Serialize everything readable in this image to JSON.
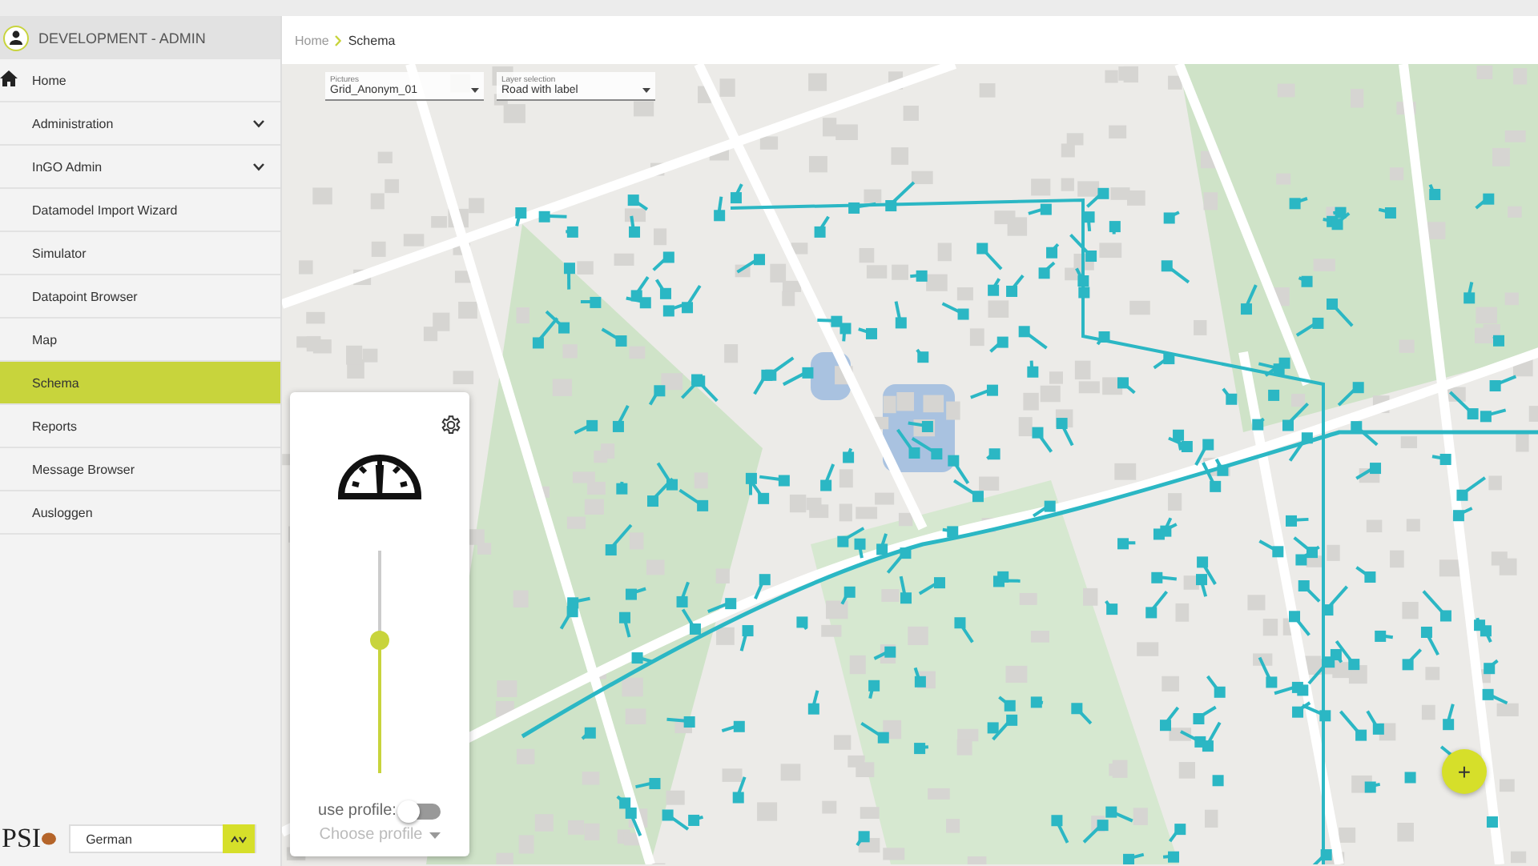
{
  "sidebar": {
    "user": "DEVELOPMENT - ADMIN",
    "items": [
      {
        "label": "Home",
        "kind": "home",
        "selected": false
      },
      {
        "label": "Administration",
        "kind": "group",
        "selected": false,
        "expanded": false
      },
      {
        "label": "InGO Admin",
        "kind": "group",
        "selected": false,
        "expanded": false
      },
      {
        "label": "Datamodel Import Wizard",
        "kind": "link",
        "selected": false
      },
      {
        "label": "Simulator",
        "kind": "link",
        "selected": false
      },
      {
        "label": "Datapoint Browser",
        "kind": "link",
        "selected": false
      },
      {
        "label": "Map",
        "kind": "link",
        "selected": false
      },
      {
        "label": "Schema",
        "kind": "link",
        "selected": true
      },
      {
        "label": "Reports",
        "kind": "link",
        "selected": false
      },
      {
        "label": "Message Browser",
        "kind": "link",
        "selected": false
      },
      {
        "label": "Ausloggen",
        "kind": "link",
        "selected": false
      }
    ],
    "logo": "PSI",
    "language": "German"
  },
  "breadcrumb": [
    "Home",
    "Schema"
  ],
  "selects": [
    {
      "label": "Pictures",
      "value": "Grid_Anonym_01"
    },
    {
      "label": "Layer selection",
      "value": "Road with label"
    }
  ],
  "panel": {
    "level": 0.6,
    "use_profile_label": "use profile:",
    "use_profile": false,
    "profile_placeholder": "Choose profile"
  },
  "fab": "+"
}
